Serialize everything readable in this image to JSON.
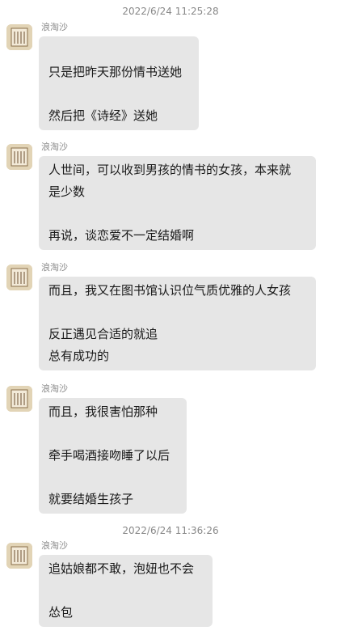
{
  "timestamps": [
    "2022/6/24 11:25:28",
    "2022/6/24 11:36:26"
  ],
  "messages": [
    {
      "sender": "浪淘沙",
      "lines": [
        "",
        "只是把昨天那份情书送她",
        "",
        "然后把《诗经》送她"
      ]
    },
    {
      "sender": "浪淘沙",
      "lines": [
        "人世间，可以收到男孩的情书的女孩，本来就",
        "是少数",
        "",
        "再说，谈恋爱不一定结婚啊"
      ]
    },
    {
      "sender": "浪淘沙",
      "lines": [
        "而且，我又在图书馆认识位气质优雅的人女孩",
        "",
        "反正遇见合适的就追",
        "总有成功的"
      ]
    },
    {
      "sender": "浪淘沙",
      "lines": [
        "而且，我很害怕那种",
        "",
        "牵手喝酒接吻睡了以后",
        "",
        "就要结婚生孩子"
      ]
    },
    {
      "sender": "浪淘沙",
      "lines": [
        "追姑娘都不敢，泡妞也不会",
        "",
        "怂包"
      ]
    }
  ],
  "colors": {
    "bubble": "#e6e6e6",
    "timestamp": "#888888",
    "sender": "#8a8a8a",
    "text": "#1a1a1a",
    "avatar": "#d9c9a8"
  },
  "icons": {
    "avatar": "profile-avatar-icon"
  }
}
